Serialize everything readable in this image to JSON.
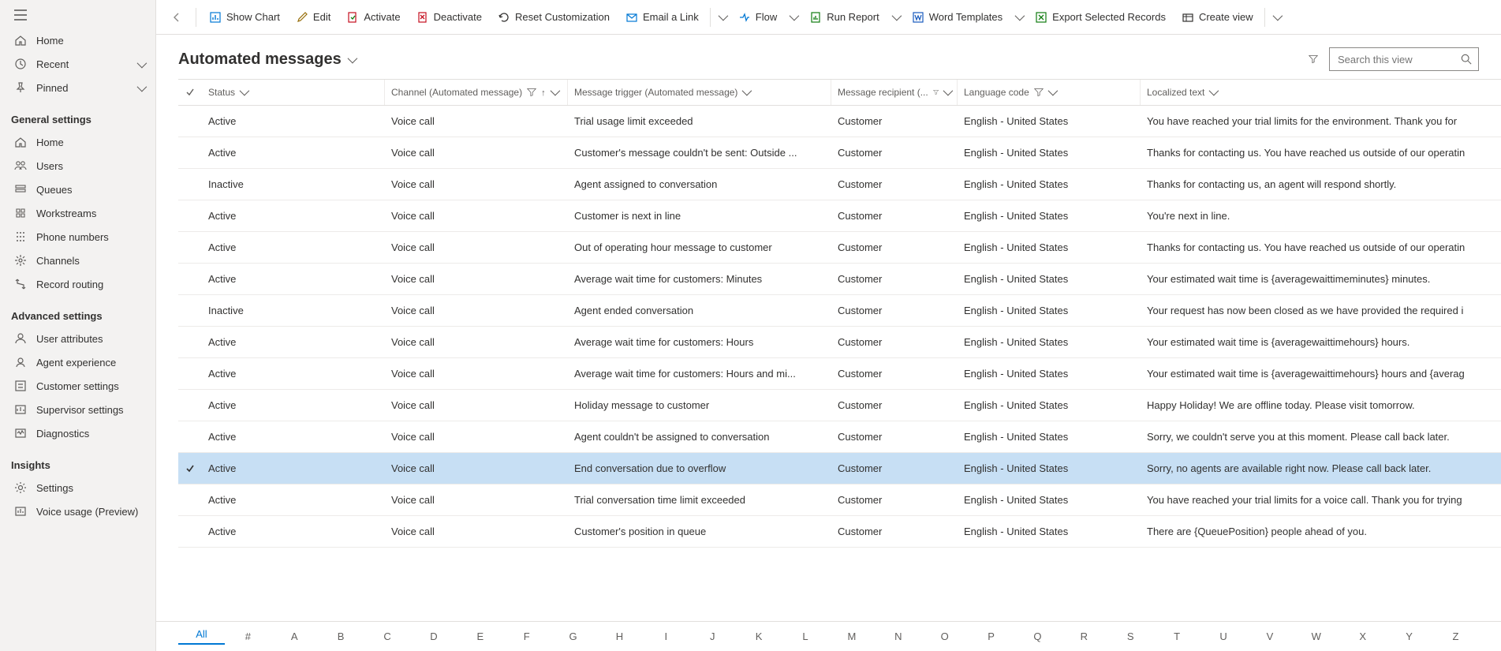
{
  "sidebar": {
    "top": [
      {
        "icon": "home",
        "label": "Home"
      },
      {
        "icon": "clock",
        "label": "Recent",
        "chev": true
      },
      {
        "icon": "pin",
        "label": "Pinned",
        "chev": true
      }
    ],
    "sections": [
      {
        "title": "General settings",
        "items": [
          {
            "icon": "home",
            "label": "Home"
          },
          {
            "icon": "users",
            "label": "Users"
          },
          {
            "icon": "queues",
            "label": "Queues"
          },
          {
            "icon": "workstreams",
            "label": "Workstreams"
          },
          {
            "icon": "phone",
            "label": "Phone numbers"
          },
          {
            "icon": "channels",
            "label": "Channels"
          },
          {
            "icon": "routing",
            "label": "Record routing"
          }
        ]
      },
      {
        "title": "Advanced settings",
        "items": [
          {
            "icon": "userattr",
            "label": "User attributes"
          },
          {
            "icon": "agent",
            "label": "Agent experience"
          },
          {
            "icon": "customer",
            "label": "Customer settings"
          },
          {
            "icon": "supervisor",
            "label": "Supervisor settings"
          },
          {
            "icon": "diag",
            "label": "Diagnostics"
          }
        ]
      },
      {
        "title": "Insights",
        "items": [
          {
            "icon": "gear",
            "label": "Settings"
          },
          {
            "icon": "voice",
            "label": "Voice usage (Preview)"
          }
        ]
      }
    ]
  },
  "commands": [
    {
      "icon": "chart",
      "label": "Show Chart",
      "color": "#0078d4"
    },
    {
      "icon": "edit",
      "label": "Edit",
      "color": "#986f0b"
    },
    {
      "icon": "activate",
      "label": "Activate",
      "color": "#c50f1f"
    },
    {
      "icon": "deactivate",
      "label": "Deactivate",
      "color": "#c50f1f"
    },
    {
      "icon": "reset",
      "label": "Reset Customization",
      "color": "#323130"
    },
    {
      "icon": "email",
      "label": "Email a Link",
      "chev": true,
      "sep": true,
      "color": "#0078d4"
    },
    {
      "icon": "flow",
      "label": "Flow",
      "chev": true,
      "color": "#0078d4"
    },
    {
      "icon": "report",
      "label": "Run Report",
      "chev": true,
      "color": "#107c10"
    },
    {
      "icon": "word",
      "label": "Word Templates",
      "chev": true,
      "color": "#185abd"
    },
    {
      "icon": "excel",
      "label": "Export Selected Records",
      "color": "#107c10"
    },
    {
      "icon": "view",
      "label": "Create view",
      "chev": true,
      "sep": true,
      "color": "#323130"
    }
  ],
  "page": {
    "title": "Automated messages",
    "search_placeholder": "Search this view"
  },
  "columns": {
    "status": "Status",
    "channel": "Channel (Automated message)",
    "trigger": "Message trigger (Automated message)",
    "recipient": "Message recipient (...",
    "lang": "Language code",
    "text": "Localized text"
  },
  "rows": [
    {
      "status": "Active",
      "channel": "Voice call",
      "trigger": "Trial usage limit exceeded",
      "recipient": "Customer",
      "lang": "English - United States",
      "text": "You have reached your trial limits for the environment. Thank you for"
    },
    {
      "status": "Active",
      "channel": "Voice call",
      "trigger": "Customer's message couldn't be sent: Outside ...",
      "recipient": "Customer",
      "lang": "English - United States",
      "text": "Thanks for contacting us. You have reached us outside of our operatin"
    },
    {
      "status": "Inactive",
      "channel": "Voice call",
      "trigger": "Agent assigned to conversation",
      "recipient": "Customer",
      "lang": "English - United States",
      "text": "Thanks for contacting us, an agent will respond shortly."
    },
    {
      "status": "Active",
      "channel": "Voice call",
      "trigger": "Customer is next in line",
      "recipient": "Customer",
      "lang": "English - United States",
      "text": "You're next in line."
    },
    {
      "status": "Active",
      "channel": "Voice call",
      "trigger": "Out of operating hour message to customer",
      "recipient": "Customer",
      "lang": "English - United States",
      "text": "Thanks for contacting us. You have reached us outside of our operatin"
    },
    {
      "status": "Active",
      "channel": "Voice call",
      "trigger": "Average wait time for customers: Minutes",
      "recipient": "Customer",
      "lang": "English - United States",
      "text": "Your estimated wait time is {averagewaittimeminutes} minutes."
    },
    {
      "status": "Inactive",
      "channel": "Voice call",
      "trigger": "Agent ended conversation",
      "recipient": "Customer",
      "lang": "English - United States",
      "text": "Your request has now been closed as we have provided the required i"
    },
    {
      "status": "Active",
      "channel": "Voice call",
      "trigger": "Average wait time for customers: Hours",
      "recipient": "Customer",
      "lang": "English - United States",
      "text": "Your estimated wait time is {averagewaittimehours} hours."
    },
    {
      "status": "Active",
      "channel": "Voice call",
      "trigger": "Average wait time for customers: Hours and mi...",
      "recipient": "Customer",
      "lang": "English - United States",
      "text": "Your estimated wait time is {averagewaittimehours} hours and {averag"
    },
    {
      "status": "Active",
      "channel": "Voice call",
      "trigger": "Holiday message to customer",
      "recipient": "Customer",
      "lang": "English - United States",
      "text": "Happy Holiday! We are offline today. Please visit tomorrow."
    },
    {
      "status": "Active",
      "channel": "Voice call",
      "trigger": "Agent couldn't be assigned to conversation",
      "recipient": "Customer",
      "lang": "English - United States",
      "text": "Sorry, we couldn't serve you at this moment. Please call back later."
    },
    {
      "status": "Active",
      "channel": "Voice call",
      "trigger": "End conversation due to overflow",
      "recipient": "Customer",
      "lang": "English - United States",
      "text": "Sorry, no agents are available right now. Please call back later.",
      "selected": true
    },
    {
      "status": "Active",
      "channel": "Voice call",
      "trigger": "Trial conversation time limit exceeded",
      "recipient": "Customer",
      "lang": "English - United States",
      "text": "You have reached your trial limits for a voice call. Thank you for trying"
    },
    {
      "status": "Active",
      "channel": "Voice call",
      "trigger": "Customer's position in queue",
      "recipient": "Customer",
      "lang": "English - United States",
      "text": "There are {QueuePosition} people ahead of you."
    }
  ],
  "alpha": [
    "All",
    "#",
    "A",
    "B",
    "C",
    "D",
    "E",
    "F",
    "G",
    "H",
    "I",
    "J",
    "K",
    "L",
    "M",
    "N",
    "O",
    "P",
    "Q",
    "R",
    "S",
    "T",
    "U",
    "V",
    "W",
    "X",
    "Y",
    "Z"
  ],
  "alpha_active": "All"
}
